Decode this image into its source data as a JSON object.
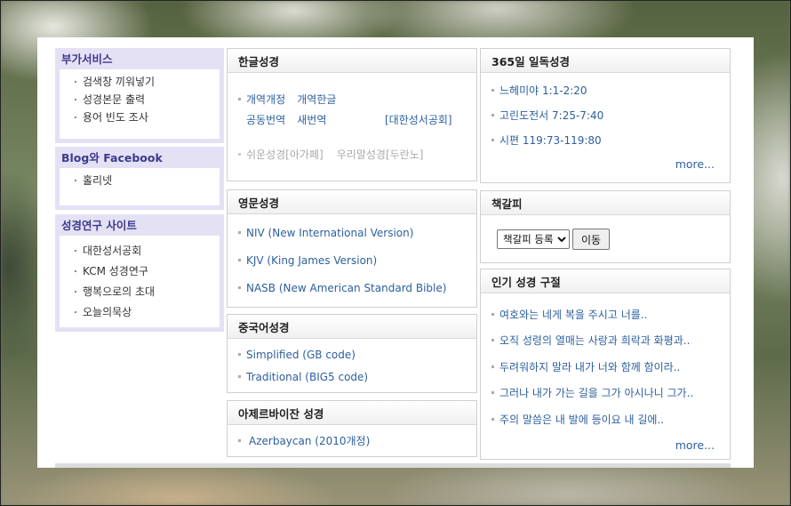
{
  "sidebar": {
    "addons": {
      "title": "부가서비스",
      "items": [
        "검색창 끼워넣기",
        "성경본문 출력",
        "용어 빈도 조사"
      ]
    },
    "blog": {
      "title": "Blog와 Facebook",
      "items": [
        "홀리넷"
      ]
    },
    "research": {
      "title": "성경연구 사이트",
      "items": [
        "대한성서공회",
        "KCM 성경연구",
        "행복으로의 초대",
        "오늘의묵상"
      ]
    }
  },
  "korean": {
    "title": "한글성경",
    "line1": [
      "개역개정",
      "개역한글"
    ],
    "line2": [
      "공동번역",
      "새번역",
      "[대한성서공회]"
    ],
    "line3": [
      "쉬운성경[아가페]",
      "우리말성경[두란노]"
    ]
  },
  "english": {
    "title": "영문성경",
    "items": [
      "NIV (New International Version)",
      "KJV (King James Version)",
      "NASB (New American Standard Bible)"
    ]
  },
  "chinese": {
    "title": "중국어성경",
    "items": [
      "Simplified (GB code)",
      "Traditional (BIG5 code)"
    ]
  },
  "azerbaijani": {
    "title": "아제르바이잔 성경",
    "items": [
      "Azerbaycan (2010개정)"
    ]
  },
  "daily": {
    "title": "365일 일독성경",
    "items": [
      "느헤미야 1:1-2:20",
      "고린도전서 7:25-7:40",
      "시편 119:73-119:80"
    ],
    "more": "more..."
  },
  "bookmark": {
    "title": "책갈피",
    "select_value": "책갈피 등록",
    "go_label": "이동"
  },
  "popular": {
    "title": "인기 성경 구절",
    "items": [
      "여호와는 네게 복을 주시고 너를..",
      "오직 성령의 열매는 사랑과 희락과 화평과..",
      "두려워하지 말라 내가 너와 함께 함이라..",
      "그러나 내가 가는 길을 그가 아시나니 그가..",
      "주의 말씀은 내 발에 등이요 내 길에.."
    ],
    "more": "more..."
  }
}
